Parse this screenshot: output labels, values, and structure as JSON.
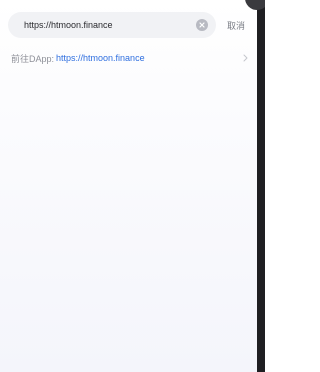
{
  "search": {
    "value": "https://htmoon.finance",
    "cancel_label": "取消"
  },
  "suggestion": {
    "prefix": "前往DApp:",
    "url": "https://htmoon.finance"
  },
  "icons": {
    "clear": "clear-circle-icon",
    "chevron": "chevron-right-icon"
  },
  "colors": {
    "link": "#2f6fdf",
    "search_bg": "#f1f2f5",
    "muted_text": "#7a7d86"
  }
}
